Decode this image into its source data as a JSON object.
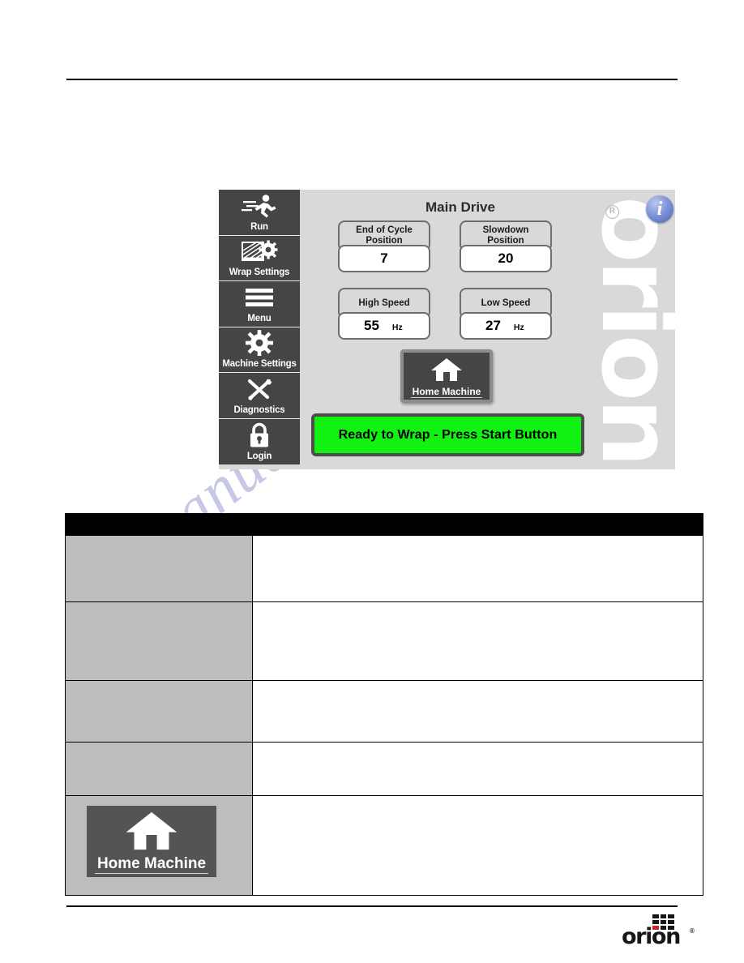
{
  "page": {
    "background_color": "#ffffff",
    "watermark_text": "manualshive.com",
    "watermark_color": "#9a9ad2"
  },
  "hmi": {
    "title": "Main Drive",
    "background_color": "#d9d9d9",
    "background_logo": "orion",
    "registered_mark": "R",
    "info_icon_glyph": "i",
    "info_icon_color": "#4963b5",
    "sidebar": {
      "items": [
        {
          "label": "Run",
          "icon": "running-person-icon"
        },
        {
          "label": "Wrap Settings",
          "icon": "film-roll-gear-icon"
        },
        {
          "label": "Menu",
          "icon": "hamburger-menu-icon"
        },
        {
          "label": "Machine Settings",
          "icon": "gear-icon"
        },
        {
          "label": "Diagnostics",
          "icon": "wrench-screwdriver-icon"
        },
        {
          "label": "Login",
          "icon": "padlock-icon"
        }
      ]
    },
    "parameters": [
      {
        "id": "end_of_cycle_position",
        "label": "End of Cycle\nPosition",
        "label_line1": "End of Cycle",
        "label_line2": "Position",
        "value": "7",
        "unit": ""
      },
      {
        "id": "slowdown_position",
        "label_line1": "Slowdown",
        "label_line2": "Position",
        "value": "20",
        "unit": ""
      },
      {
        "id": "high_speed",
        "label_line1": "High Speed",
        "label_line2": "",
        "value": "55",
        "unit": "Hz"
      },
      {
        "id": "low_speed",
        "label_line1": "Low Speed",
        "label_line2": "",
        "value": "27",
        "unit": "Hz"
      }
    ],
    "home_button": {
      "label": "Home Machine",
      "icon": "home-icon"
    },
    "status_banner": {
      "text": "Ready to Wrap - Press Start Button",
      "color": "#12f212"
    }
  },
  "description_table": {
    "headers": [
      "",
      ""
    ],
    "rows": [
      {
        "icon": "",
        "description": ""
      },
      {
        "icon": "",
        "description": ""
      },
      {
        "icon": "",
        "description": ""
      },
      {
        "icon": "",
        "description": ""
      },
      {
        "icon": "home-machine-button",
        "icon_label": "Home Machine",
        "description": ""
      }
    ]
  },
  "footer": {
    "logo_word": "orion",
    "logo_registered": "®",
    "logo_accent_color": "#cf2229",
    "logo_dark_color": "#171717"
  }
}
